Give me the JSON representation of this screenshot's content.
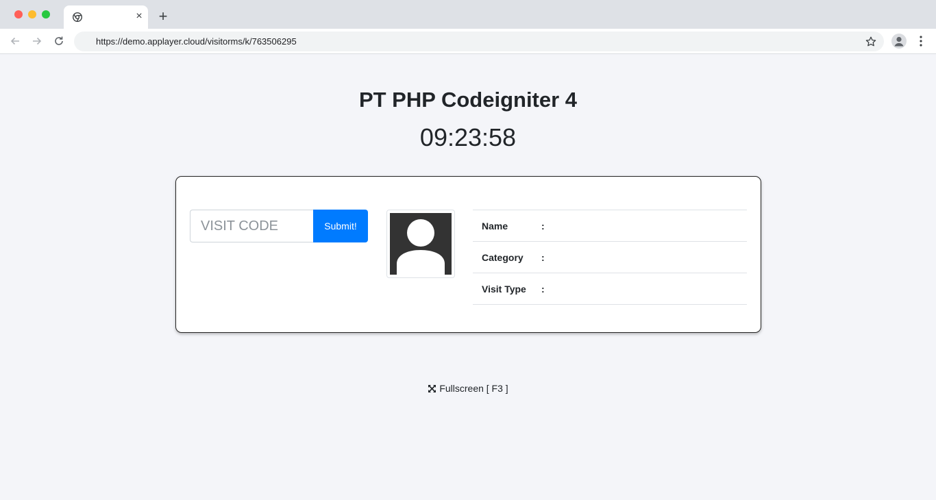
{
  "browser": {
    "tab": {
      "favicon": "chrome-favicon-icon",
      "close_label": "×"
    },
    "newtab_label": "+",
    "url": "https://demo.applayer.cloud/visitorms/k/763506295",
    "icons": [
      "back-arrow-icon",
      "forward-arrow-icon",
      "reload-icon",
      "star-icon",
      "profile-icon",
      "more-vert-icon"
    ]
  },
  "page": {
    "title": "PT PHP Codeigniter 4",
    "clock": "09:23:58"
  },
  "form": {
    "code_placeholder": "VISIT CODE",
    "code_value": "",
    "submit_label": "Submit!"
  },
  "visitor": {
    "photo": "avatar-placeholder-icon",
    "rows": [
      {
        "label": "Name",
        "sep": ":",
        "value": ""
      },
      {
        "label": "Category",
        "sep": ":",
        "value": ""
      },
      {
        "label": "Visit Type",
        "sep": ":",
        "value": ""
      }
    ]
  },
  "footer": {
    "fullscreen_label": "Fullscreen [ F3 ]"
  },
  "colors": {
    "accent": "#007bff",
    "background": "#f4f5f9",
    "avatar_bg": "#333333"
  }
}
